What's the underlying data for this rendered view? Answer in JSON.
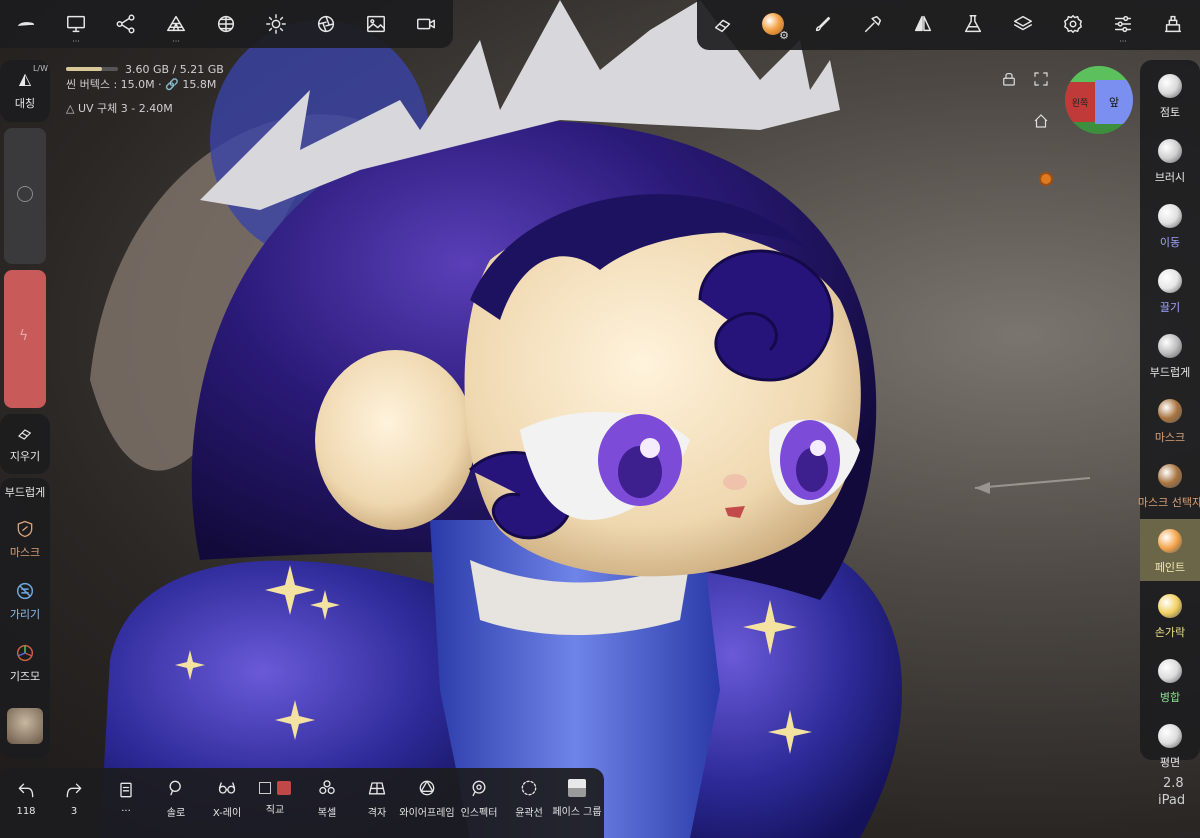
{
  "stats": {
    "memory": "3.60 GB / 5.21 GB",
    "scene_vertices": "씬 버텍스 : 15.0M · 🔗 15.8M",
    "memory_fill": 0.69,
    "mesh_name": "UV 구체 3",
    "mesh_count": "- 2.40M"
  },
  "left_panel": {
    "symmetry_badge": "L/W",
    "symmetry_label": "대칭",
    "eraser_label": "지우기",
    "smooth_label": "부드럽게",
    "mask_label": "마스크",
    "hide_label": "가리기",
    "gizmo_label": "기즈모"
  },
  "right_tools": [
    {
      "label": "점토",
      "color": "#e8e8e8",
      "ball": "#d9d9d9"
    },
    {
      "label": "브러시",
      "color": "#e8e8e8",
      "ball": "#cfcfcf"
    },
    {
      "label": "이동",
      "color": "#9fa6ff",
      "ball": "#e0e0e0"
    },
    {
      "label": "끌기",
      "color": "#9fa6ff",
      "ball": "#e6e6e6"
    },
    {
      "label": "부드럽게",
      "color": "#e8e8e8",
      "ball": "#bdbdbd"
    },
    {
      "label": "마스크",
      "color": "#d8a27a",
      "ball": "#a8743f"
    },
    {
      "label": "마스크 선택자",
      "color": "#d8a27a",
      "ball": "#a8743f"
    },
    {
      "label": "페인트",
      "color": "#f2e8b0",
      "ball": "#f4a44a"
    },
    {
      "label": "손가락",
      "color": "#f2e08a",
      "ball": "#f2d060"
    },
    {
      "label": "병합",
      "color": "#8ee08e",
      "ball": "#dcdcdc"
    },
    {
      "label": "평면",
      "color": "#e8e8e8",
      "ball": "#dcdcdc"
    }
  ],
  "gizmo_cube": {
    "right_label": "왼쪽",
    "front_label": "앞"
  },
  "bottom_toolbar": [
    {
      "label": "118",
      "icon": "undo-icon"
    },
    {
      "label": "3",
      "icon": "redo-icon"
    },
    {
      "label": "···",
      "icon": "history-icon"
    },
    {
      "label": "솔로",
      "icon": "solo-search-icon"
    },
    {
      "label": "X-레이",
      "icon": "xray-glasses-icon"
    },
    {
      "label": "직교",
      "icon": "ortho-cube-icon"
    },
    {
      "label": "복셀",
      "icon": "voxel-icon"
    },
    {
      "label": "격자",
      "icon": "grid-icon"
    },
    {
      "label": "와이어프레임",
      "icon": "wireframe-icon"
    },
    {
      "label": "인스펙터",
      "icon": "inspector-eye-icon"
    },
    {
      "label": "윤곽선",
      "icon": "outline-icon"
    },
    {
      "label": "페이스 그룹",
      "icon": "face-group-icon"
    }
  ],
  "version": {
    "number": "2.8",
    "device": "iPad"
  },
  "colors": {
    "accent_yellow": "#f2e8b0",
    "active_tool_bg": "#6b6648",
    "lightning_panel": "#c85a5a",
    "paint_orange": "#f4a44a"
  }
}
